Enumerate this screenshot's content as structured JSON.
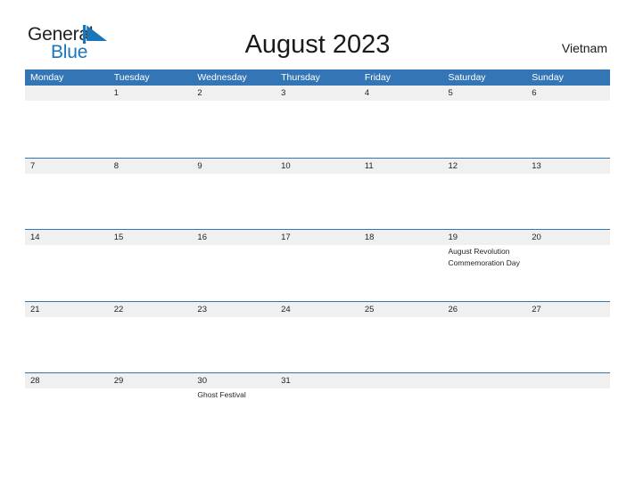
{
  "brand": {
    "name_top": "General",
    "name_bottom": "Blue",
    "flag_icon": "blue-flag-triangle-icon",
    "color_dark": "#231f20",
    "color_blue": "#1b75bb"
  },
  "header": {
    "title": "August 2023",
    "region": "Vietnam"
  },
  "theme": {
    "header_blue": "#3476b5",
    "band_gray": "#f0f0f0",
    "text": "#231f20",
    "page_background": "#ffffff"
  },
  "calendar": {
    "month": "August",
    "year": "2023",
    "weekday_headers": [
      "Monday",
      "Tuesday",
      "Wednesday",
      "Thursday",
      "Friday",
      "Saturday",
      "Sunday"
    ],
    "weeks": [
      {
        "days": [
          {
            "num": "",
            "events": []
          },
          {
            "num": "1",
            "events": []
          },
          {
            "num": "2",
            "events": []
          },
          {
            "num": "3",
            "events": []
          },
          {
            "num": "4",
            "events": []
          },
          {
            "num": "5",
            "events": []
          },
          {
            "num": "6",
            "events": []
          }
        ]
      },
      {
        "days": [
          {
            "num": "7",
            "events": []
          },
          {
            "num": "8",
            "events": []
          },
          {
            "num": "9",
            "events": []
          },
          {
            "num": "10",
            "events": []
          },
          {
            "num": "11",
            "events": []
          },
          {
            "num": "12",
            "events": []
          },
          {
            "num": "13",
            "events": []
          }
        ]
      },
      {
        "days": [
          {
            "num": "14",
            "events": []
          },
          {
            "num": "15",
            "events": []
          },
          {
            "num": "16",
            "events": []
          },
          {
            "num": "17",
            "events": []
          },
          {
            "num": "18",
            "events": []
          },
          {
            "num": "19",
            "events": [
              "August Revolution Commemoration Day"
            ]
          },
          {
            "num": "20",
            "events": []
          }
        ]
      },
      {
        "days": [
          {
            "num": "21",
            "events": []
          },
          {
            "num": "22",
            "events": []
          },
          {
            "num": "23",
            "events": []
          },
          {
            "num": "24",
            "events": []
          },
          {
            "num": "25",
            "events": []
          },
          {
            "num": "26",
            "events": []
          },
          {
            "num": "27",
            "events": []
          }
        ]
      },
      {
        "days": [
          {
            "num": "28",
            "events": []
          },
          {
            "num": "29",
            "events": []
          },
          {
            "num": "30",
            "events": [
              "Ghost Festival"
            ]
          },
          {
            "num": "31",
            "events": []
          },
          {
            "num": "",
            "events": []
          },
          {
            "num": "",
            "events": []
          },
          {
            "num": "",
            "events": []
          }
        ]
      }
    ]
  }
}
